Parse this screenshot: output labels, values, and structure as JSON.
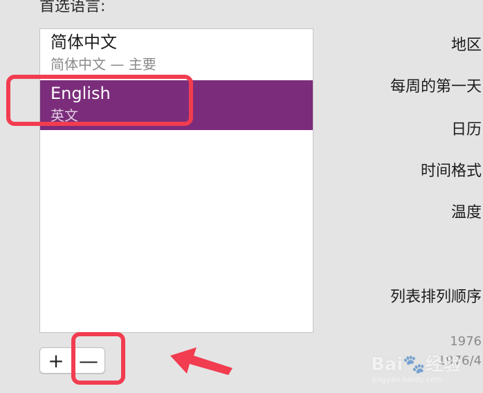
{
  "section_title": "首选语言:",
  "languages": [
    {
      "name": "简体中文",
      "subtitle": "简体中文 — 主要",
      "selected": false
    },
    {
      "name": "English",
      "subtitle": "英文",
      "selected": true
    }
  ],
  "buttons": {
    "add": "+",
    "remove": "—"
  },
  "settings_labels": {
    "region": "地区",
    "first_day": "每周的第一天",
    "calendar": "日历",
    "time_format": "时间格式",
    "temperature": "温度",
    "list_order": "列表排列顺序"
  },
  "preview": {
    "line1": "1976",
    "line2": "1976/4"
  },
  "colors": {
    "selection": "#7b2d7b",
    "annotation": "#f23c50"
  }
}
